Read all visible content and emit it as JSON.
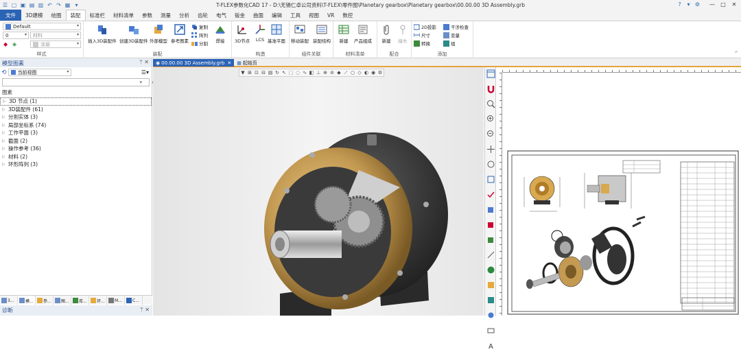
{
  "app": {
    "title": "T-FLEX参数化CAD 17 - D:\\无锡仁卓公司资料\\T-FLEX\\零件图\\Planetary gearbox\\Planetary gearbox\\00.00.00 3D Assembly.grb"
  },
  "ribbon_tabs": [
    "文件",
    "3D建模",
    "绘图",
    "装配",
    "标准栏",
    "材料清单",
    "参数",
    "测量",
    "分析",
    "齿轮",
    "电气",
    "钣金",
    "曲面",
    "编辑",
    "工具",
    "视图",
    "VR",
    "数控"
  ],
  "active_tab": "装配",
  "ribbon": {
    "style_group": {
      "label": "样式",
      "layer_value": "Default",
      "line_value": "0",
      "material_value": "材料",
      "color_value": "涂层"
    },
    "assembly_group": {
      "label": "装配",
      "buttons": [
        "插入3D装配件",
        "创建3D装配件",
        "外部模型",
        "参考图素"
      ],
      "small": [
        "复制",
        "阵列",
        "分割"
      ],
      "weld": "焊接"
    },
    "structure_group": {
      "label": "构造",
      "buttons": [
        "3D节点",
        "LCS",
        "基准平面"
      ]
    },
    "component_group": {
      "label": "组件关联",
      "buttons": [
        "移动装配",
        "装配结构"
      ]
    },
    "bom_group": {
      "label": "材料清单",
      "buttons": [
        "新建",
        "产品组成"
      ]
    },
    "mate_group": {
      "label": "配合",
      "buttons": [
        "新建",
        "接头"
      ]
    },
    "add_group": {
      "label": "添加",
      "small": [
        "2D投影",
        "尺寸",
        "转换",
        "干涉检查",
        "变量",
        "组"
      ]
    }
  },
  "left_panel": {
    "title": "模型图素",
    "view_select": "当前视图",
    "search_placeholder": "",
    "tree_header": "图素",
    "items": [
      "3D 节点 (1)",
      "3D装配件 (61)",
      "分割实体 (3)",
      "局部坐标系 (74)",
      "工作平面 (3)",
      "截面 (2)",
      "操作参考 (36)",
      "材料 (2)",
      "环形阵列 (3)"
    ],
    "bottom_tabs": [
      "3...",
      "模...",
      "参...",
      "图...",
      "库...",
      "环...",
      "M...",
      "C..."
    ],
    "diagnostics_title": "诊断"
  },
  "doc_tabs": [
    "00.00.00 3D Assembly.grb",
    "起始页"
  ],
  "colors": {
    "accent_blue": "#2b63b5",
    "tab_orange": "#e8a33c",
    "housing_dark": "#2d2d2d",
    "brass": "#c49a52"
  }
}
